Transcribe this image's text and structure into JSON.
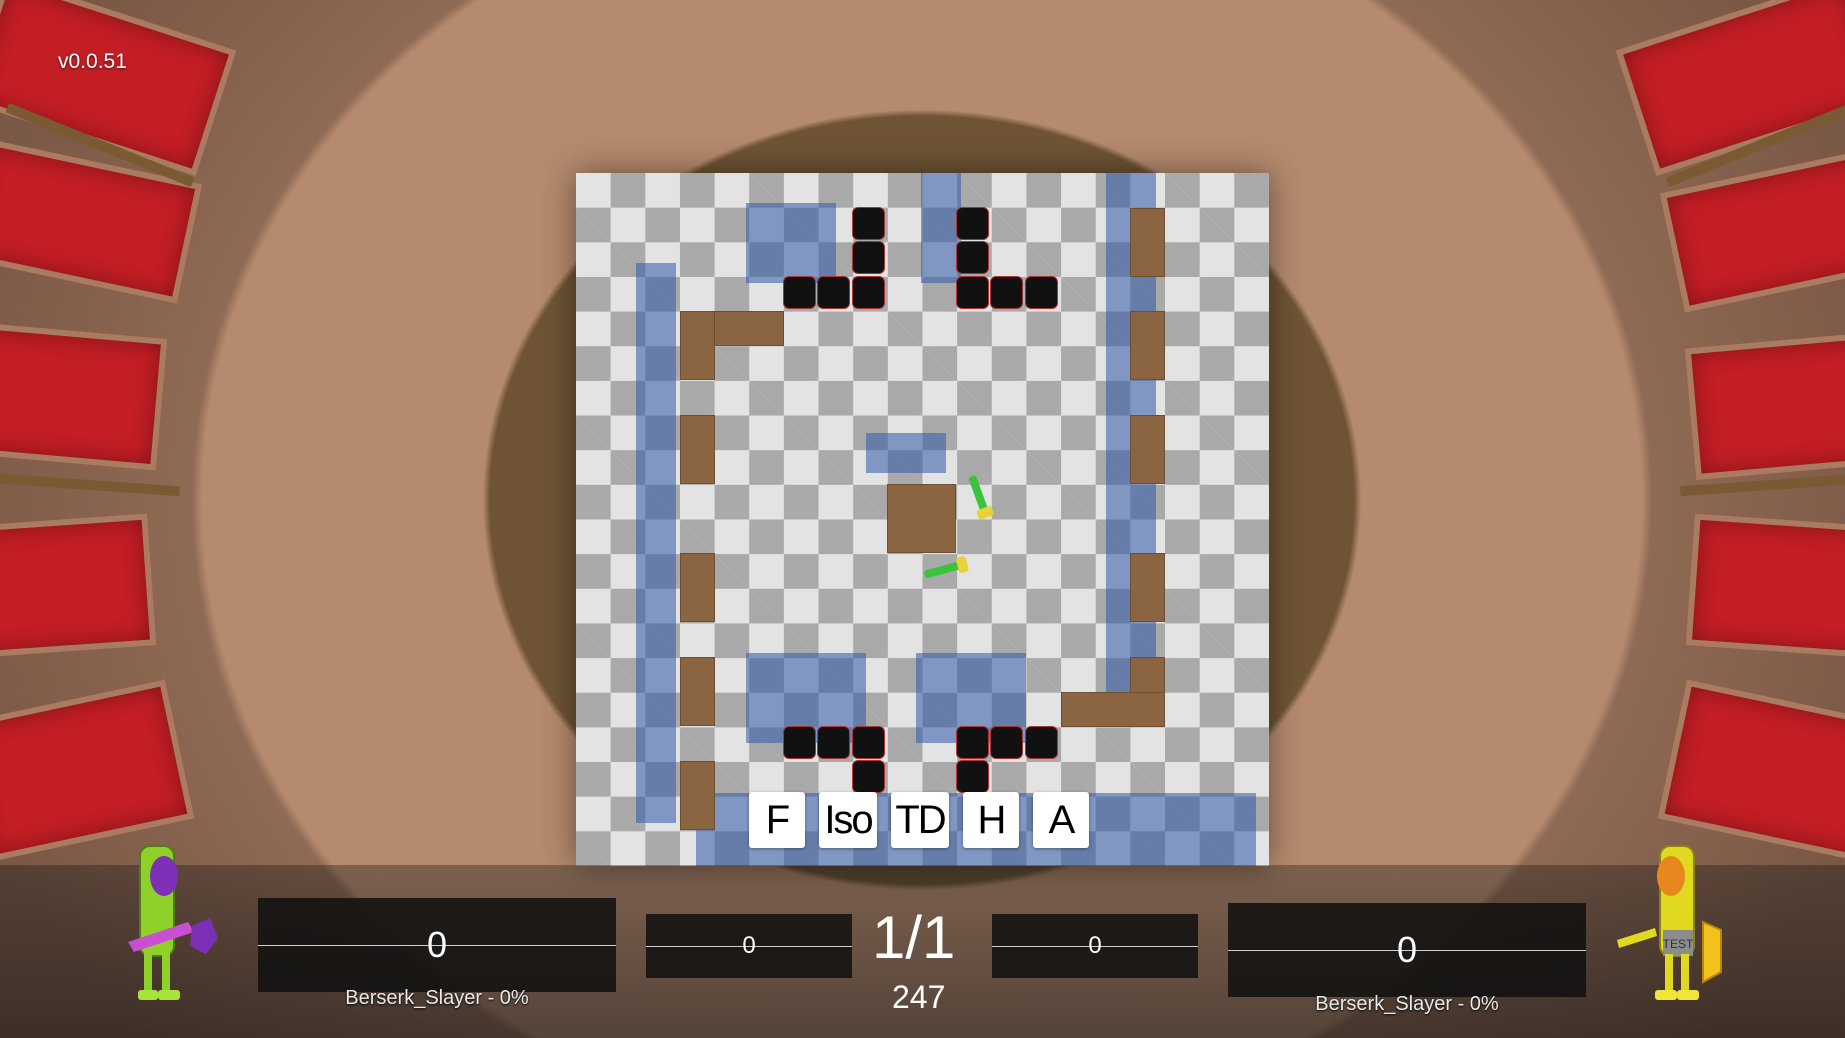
{
  "version": "v0.0.51",
  "camera_buttons": [
    "F",
    "Iso",
    "TD",
    "H",
    "A"
  ],
  "hud": {
    "round": "1/1",
    "timer": "247",
    "left": {
      "main_score": "0",
      "sub_score": "0",
      "label": "Berserk_Slayer - 0%"
    },
    "right": {
      "main_score": "0",
      "sub_score": "0",
      "label": "Berserk_Slayer - 0%"
    }
  },
  "players": {
    "left_avatar": {
      "body_color": "#8fd12a",
      "accent_color": "#7d2fb7"
    },
    "right_avatar": {
      "body_color": "#e0d920",
      "accent_color": "#e9871f",
      "shirt_text": "TEST"
    }
  },
  "colors": {
    "seat_red": "#c21e24",
    "wood": "#8b6442",
    "pit": "#111111"
  }
}
